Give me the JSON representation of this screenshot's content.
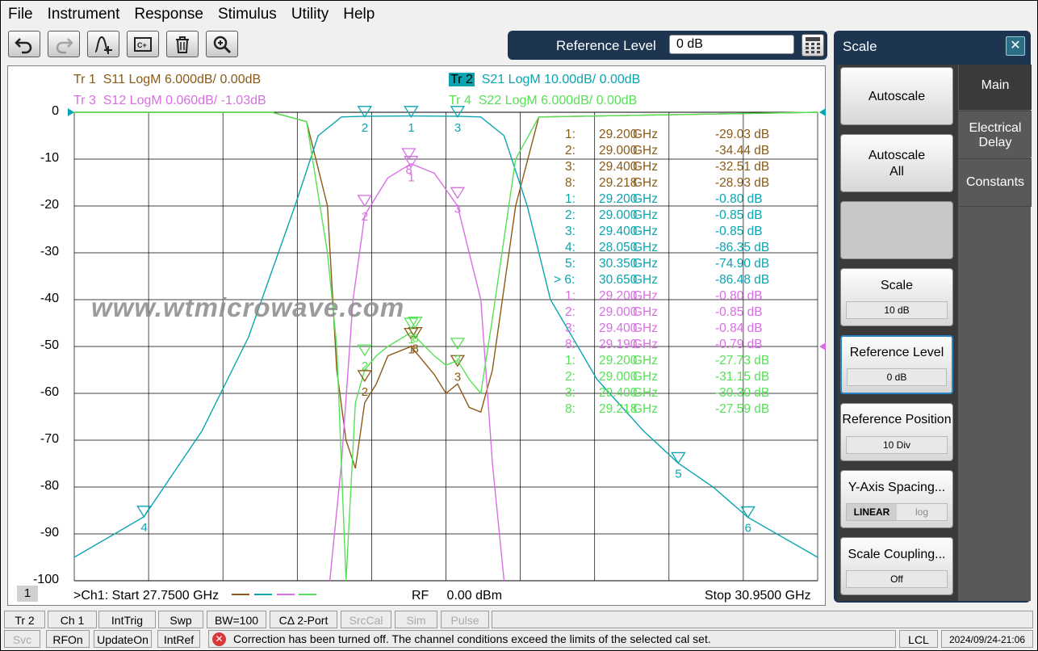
{
  "menu": [
    "File",
    "Instrument",
    "Response",
    "Stimulus",
    "Utility",
    "Help"
  ],
  "toolbar": {
    "buttons": [
      "undo-icon",
      "redo-icon",
      "add-trace-icon",
      "channel-icon",
      "delete-icon",
      "zoom-icon"
    ]
  },
  "reference_level": {
    "label": "Reference Level",
    "value": "0 dB"
  },
  "traces": [
    {
      "tag": "Tr  1",
      "desc": "S11 LogM 6.000dB/  0.00dB",
      "color": "#8b5a16"
    },
    {
      "tag": "Tr  2",
      "desc": "S21 LogM 10.00dB/  0.00dB",
      "color": "#0aa5b0"
    },
    {
      "tag": "Tr  3",
      "desc": "S12 LogM 0.060dB/  -1.03dB",
      "color": "#d86fe3"
    },
    {
      "tag": "Tr  4",
      "desc": "S22 LogM 6.000dB/  0.00dB",
      "color": "#55e255"
    }
  ],
  "y_ticks": [
    "0",
    "-10",
    "-20",
    "-30",
    "-40",
    "-50",
    "-60",
    "-70",
    "-80",
    "-90",
    "-100"
  ],
  "markers": [
    {
      "n": "1:",
      "f": "29.200",
      "u": "GHz",
      "v": "-29.03 dB",
      "color": "#8b5a16"
    },
    {
      "n": "2:",
      "f": "29.000",
      "u": "GHz",
      "v": "-34.44 dB",
      "color": "#8b5a16"
    },
    {
      "n": "3:",
      "f": "29.400",
      "u": "GHz",
      "v": "-32.51 dB",
      "color": "#8b5a16"
    },
    {
      "n": "8:",
      "f": "29.218",
      "u": "GHz",
      "v": "-28.93 dB",
      "color": "#8b5a16"
    },
    {
      "n": "1:",
      "f": "29.200",
      "u": "GHz",
      "v": "-0.80 dB",
      "color": "#0aa5b0"
    },
    {
      "n": "2:",
      "f": "29.000",
      "u": "GHz",
      "v": "-0.85 dB",
      "color": "#0aa5b0"
    },
    {
      "n": "3:",
      "f": "29.400",
      "u": "GHz",
      "v": "-0.85 dB",
      "color": "#0aa5b0"
    },
    {
      "n": "4:",
      "f": "28.050",
      "u": "GHz",
      "v": "-86.35 dB",
      "color": "#0aa5b0"
    },
    {
      "n": "5:",
      "f": "30.350",
      "u": "GHz",
      "v": "-74.90 dB",
      "color": "#0aa5b0"
    },
    {
      "n": "> 6:",
      "f": "30.650",
      "u": "GHz",
      "v": "-86.48 dB",
      "color": "#0aa5b0"
    },
    {
      "n": "1:",
      "f": "29.200",
      "u": "GHz",
      "v": "-0.80 dB",
      "color": "#d86fe3"
    },
    {
      "n": "2:",
      "f": "29.000",
      "u": "GHz",
      "v": "-0.85 dB",
      "color": "#d86fe3"
    },
    {
      "n": "3:",
      "f": "29.400",
      "u": "GHz",
      "v": "-0.84 dB",
      "color": "#d86fe3"
    },
    {
      "n": "8:",
      "f": "29.190",
      "u": "GHz",
      "v": "-0.79 dB",
      "color": "#d86fe3"
    },
    {
      "n": "1:",
      "f": "29.200",
      "u": "GHz",
      "v": "-27.73 dB",
      "color": "#55e255"
    },
    {
      "n": "2:",
      "f": "29.000",
      "u": "GHz",
      "v": "-31.15 dB",
      "color": "#55e255"
    },
    {
      "n": "3:",
      "f": "29.400",
      "u": "GHz",
      "v": "-30.30 dB",
      "color": "#55e255"
    },
    {
      "n": "8:",
      "f": "29.218",
      "u": "GHz",
      "v": "-27.59 dB",
      "color": "#55e255"
    }
  ],
  "watermark": "www.wtmicrowave.com",
  "channel_number": "1",
  "footer": {
    "start": ">Ch1:  Start  27.7500 GHz",
    "rf": "RF     0.00 dBm",
    "stop": "Stop  30.9500 GHz"
  },
  "panel": {
    "title": "Scale",
    "close": "✕",
    "buttons": [
      {
        "label": "Autoscale"
      },
      {
        "label": "Autoscale\nAll"
      },
      {
        "label": ""
      },
      {
        "label": "Scale",
        "value": "10 dB"
      },
      {
        "label": "Reference Level",
        "value": "0 dB"
      },
      {
        "label": "Reference Position",
        "value": "10 Div"
      },
      {
        "label": "Y-Axis Spacing...",
        "opt1": "LINEAR",
        "opt2": "log"
      },
      {
        "label": "Scale Coupling...",
        "value": "Off"
      }
    ],
    "tabs": [
      "Main",
      "Electrical\nDelay",
      "Constants"
    ]
  },
  "status_row1": [
    "Tr 2",
    "Ch 1",
    "IntTrig",
    "Swp",
    "BW=100",
    "CΔ 2-Port",
    "SrcCal",
    "Sim",
    "Pulse"
  ],
  "status_row2": [
    "Svc",
    "RFOn",
    "UpdateOn",
    "IntRef"
  ],
  "status_message": "Correction has been turned off. The channel conditions exceed the limits of the selected cal set.",
  "status_lcl": "LCL",
  "status_time": "2024/09/24-21:06",
  "chart_data": {
    "type": "line",
    "xlabel": "",
    "ylabel": "",
    "x_range_ghz": [
      27.75,
      30.95
    ],
    "ylim": [
      -100,
      0
    ],
    "series": [
      {
        "name": "S11",
        "x": [
          27.75,
          28.6,
          28.75,
          28.84,
          28.88,
          28.92,
          28.96,
          29.0,
          29.05,
          29.1,
          29.2,
          29.3,
          29.35,
          29.4,
          29.45,
          29.5,
          29.55,
          29.65,
          29.75,
          30.95
        ],
        "y": [
          0,
          0,
          -2,
          -20,
          -55,
          -70,
          -76,
          -62,
          -58,
          -52,
          -50,
          -56,
          -60,
          -58,
          -63,
          -64,
          -55,
          -20,
          -1,
          0
        ]
      },
      {
        "name": "S21",
        "x": [
          27.75,
          28.05,
          28.3,
          28.5,
          28.7,
          28.8,
          28.9,
          29.0,
          29.2,
          29.4,
          29.5,
          29.6,
          29.7,
          29.8,
          30.0,
          30.2,
          30.35,
          30.5,
          30.65,
          30.95
        ],
        "y": [
          -95,
          -86.35,
          -68,
          -48,
          -20,
          -5,
          -1,
          -0.85,
          -0.8,
          -0.85,
          -1,
          -5,
          -20,
          -40,
          -57,
          -68,
          -74.9,
          -80,
          -86.48,
          -95
        ]
      },
      {
        "name": "S12",
        "x": [
          28.85,
          28.9,
          28.95,
          29.0,
          29.1,
          29.2,
          29.3,
          29.4,
          29.5,
          29.55,
          29.6
        ],
        "y": [
          -100,
          -75,
          -40,
          -22,
          -14,
          -11,
          -13,
          -20,
          -40,
          -75,
          -100
        ]
      },
      {
        "name": "S22",
        "x": [
          27.75,
          28.6,
          28.75,
          28.84,
          28.88,
          28.92,
          28.96,
          29.0,
          29.05,
          29.1,
          29.2,
          29.3,
          29.35,
          29.4,
          29.45,
          29.5,
          29.55,
          29.65,
          29.75,
          30.95
        ],
        "y": [
          0,
          0,
          -2,
          -30,
          -50,
          -100,
          -62,
          -55,
          -52,
          -50,
          -47,
          -52,
          -54,
          -53,
          -57,
          -60,
          -44,
          -10,
          -1,
          0
        ]
      }
    ]
  }
}
